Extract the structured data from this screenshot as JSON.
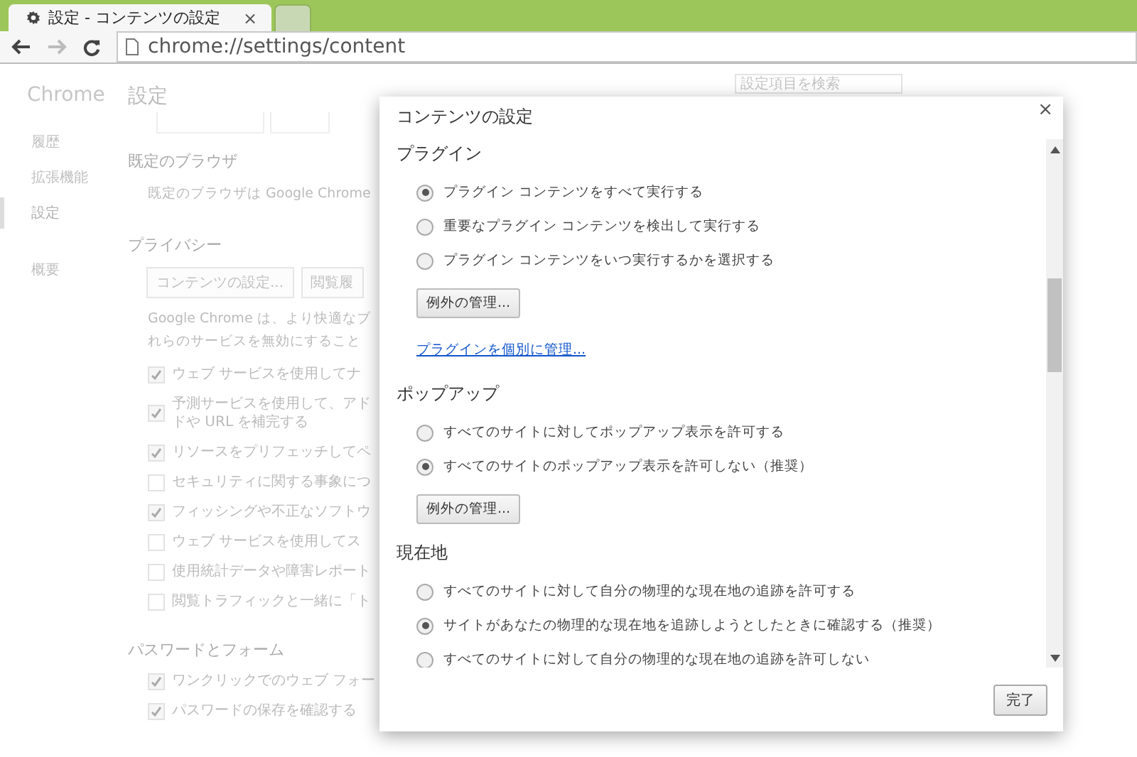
{
  "browser": {
    "tabs": [
      {
        "title": "設定 - コンテンツの設定",
        "close": "×",
        "selected": true
      },
      {
        "selected": false
      }
    ],
    "url": "chrome://settings/content"
  },
  "sidebar": {
    "title": "Chrome",
    "items": [
      {
        "label": "履歴",
        "selected": false
      },
      {
        "label": "拡張機能",
        "selected": false
      },
      {
        "label": "設定",
        "selected": true
      },
      {
        "label": "概要",
        "selected": false
      }
    ]
  },
  "settings": {
    "title": "設定",
    "search": {
      "placeholder": "設定項目を検索"
    },
    "sections": [
      {
        "heading": "既定のブラウザ",
        "items": [
          {
            "kind": "text",
            "lines": [
              "既定のブラウザは Google Chrome"
            ]
          }
        ]
      },
      {
        "heading": "プライバシー",
        "items": [
          {
            "kind": "buttons",
            "labels": [
              "コンテンツの設定...",
              "閲覧履"
            ]
          },
          {
            "kind": "text",
            "lines": [
              "Google Chrome は、より快適なブ",
              "れらのサービスを無効にすること"
            ]
          },
          {
            "kind": "checkbox",
            "lines": [
              "ウェブ サービスを使用してナ"
            ],
            "checked": true
          },
          {
            "kind": "checkbox",
            "lines": [
              "予測サービスを使用して、アド",
              "ドや URL を補完する"
            ],
            "checked": true
          },
          {
            "kind": "checkbox",
            "lines": [
              "リソースをプリフェッチしてペ"
            ],
            "checked": true
          },
          {
            "kind": "checkbox",
            "lines": [
              "セキュリティに関する事象につ"
            ],
            "checked": false
          },
          {
            "kind": "checkbox",
            "lines": [
              "フィッシングや不正なソフトウ"
            ],
            "checked": true
          },
          {
            "kind": "checkbox",
            "lines": [
              "ウェブ サービスを使用してス"
            ],
            "checked": false
          },
          {
            "kind": "checkbox",
            "lines": [
              "使用統計データや障害レポート"
            ],
            "checked": false
          },
          {
            "kind": "checkbox",
            "lines": [
              "閲覧トラフィックと一緒に「ト"
            ],
            "checked": false
          }
        ]
      },
      {
        "heading": "パスワードとフォーム",
        "items": [
          {
            "kind": "checkbox",
            "lines": [
              "ワンクリックでのウェブ フォー"
            ],
            "checked": true
          },
          {
            "kind": "checkbox",
            "lines": [
              "パスワードの保存を確認する"
            ],
            "checked": true
          }
        ]
      }
    ]
  },
  "dialog": {
    "title": "コンテンツの設定",
    "close": "×",
    "done": "完了",
    "sections": [
      {
        "heading": "プラグイン",
        "options": [
          {
            "label": "プラグイン コンテンツをすべて実行する",
            "selected": true
          },
          {
            "label": "重要なプラグイン コンテンツを検出して実行する",
            "selected": false
          },
          {
            "label": "プラグイン コンテンツをいつ実行するかを選択する",
            "selected": false
          }
        ],
        "button": "例外の管理...",
        "link": "プラグインを個別に管理..."
      },
      {
        "heading": "ポップアップ",
        "options": [
          {
            "label": "すべてのサイトに対してポップアップ表示を許可する",
            "selected": false
          },
          {
            "label": "すべてのサイトのポップアップ表示を許可しない（推奨）",
            "selected": true
          }
        ],
        "button": "例外の管理..."
      },
      {
        "heading": "現在地",
        "options": [
          {
            "label": "すべてのサイトに対して自分の物理的な現在地の追跡を許可する",
            "selected": false
          },
          {
            "label": "サイトがあなたの物理的な現在地を追跡しようとしたときに確認する（推奨）",
            "selected": true
          },
          {
            "label": "すべてのサイトに対して自分の物理的な現在地の追跡を許可しない",
            "selected": false
          }
        ]
      }
    ]
  }
}
